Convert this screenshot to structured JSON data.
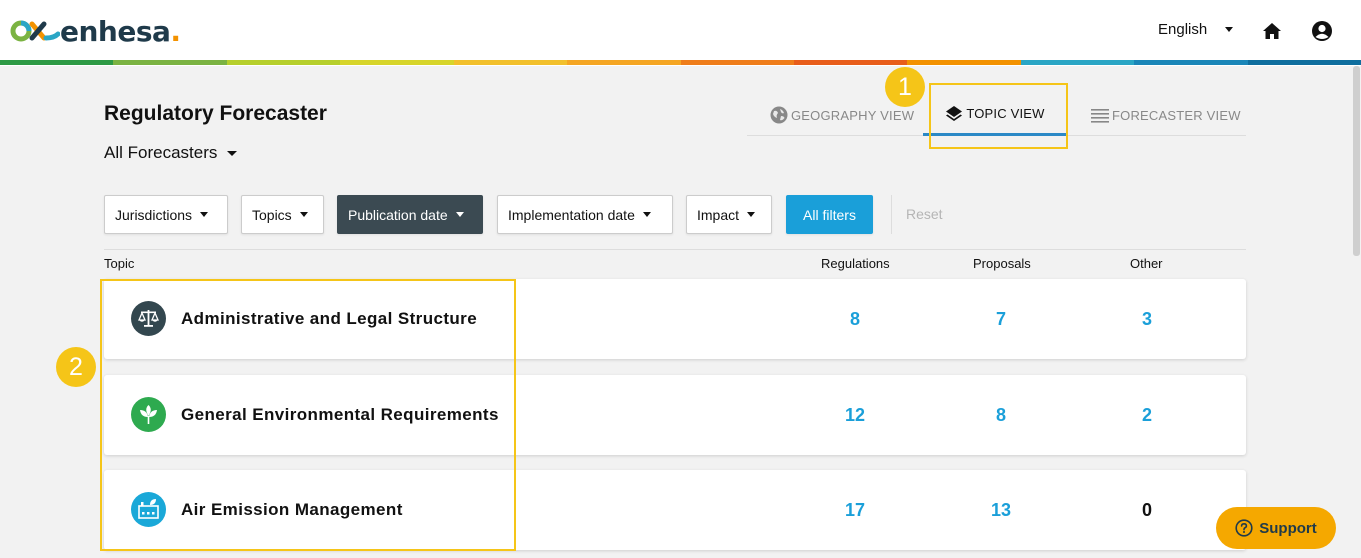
{
  "header": {
    "logo_text": "enhesa",
    "logo_dot": ".",
    "language": "English",
    "rainbow": [
      "#2e9a45",
      "#7bb342",
      "#b6cf2c",
      "#d7d52a",
      "#f2c02c",
      "#f5a623",
      "#ef7d1a",
      "#e85d1a",
      "#f39200",
      "#2aa6c5",
      "#1a86b8",
      "#0f6e9e"
    ]
  },
  "page": {
    "title": "Regulatory Forecaster",
    "forecaster_select": "All Forecasters"
  },
  "view_tabs": {
    "geography": "GEOGRAPHY VIEW",
    "topic": "TOPIC VIEW",
    "forecaster": "FORECASTER VIEW",
    "active": "topic"
  },
  "filters": {
    "jurisdictions": "Jurisdictions",
    "topics": "Topics",
    "publication_date": "Publication date",
    "implementation_date": "Implementation date",
    "impact": "Impact",
    "all_filters": "All filters",
    "reset": "Reset"
  },
  "table": {
    "columns": {
      "topic": "Topic",
      "regulations": "Regulations",
      "proposals": "Proposals",
      "other": "Other"
    },
    "rows": [
      {
        "name": "Administrative and Legal Structure",
        "regulations": "8",
        "proposals": "7",
        "other": "3",
        "icon": "scales-icon",
        "icon_color": "#33474f"
      },
      {
        "name": "General Environmental Requirements",
        "regulations": "12",
        "proposals": "8",
        "other": "2",
        "icon": "leaf-icon",
        "icon_color": "#2eaa4f"
      },
      {
        "name": "Air Emission Management",
        "regulations": "17",
        "proposals": "13",
        "other": "0",
        "icon": "factory-icon",
        "icon_color": "#1aa8d8"
      }
    ]
  },
  "callouts": {
    "one": "1",
    "two": "2"
  },
  "support": {
    "label": "Support"
  },
  "colors": {
    "accent": "#1a9fd9",
    "highlight": "#f5c518",
    "support": "#f5a800"
  }
}
